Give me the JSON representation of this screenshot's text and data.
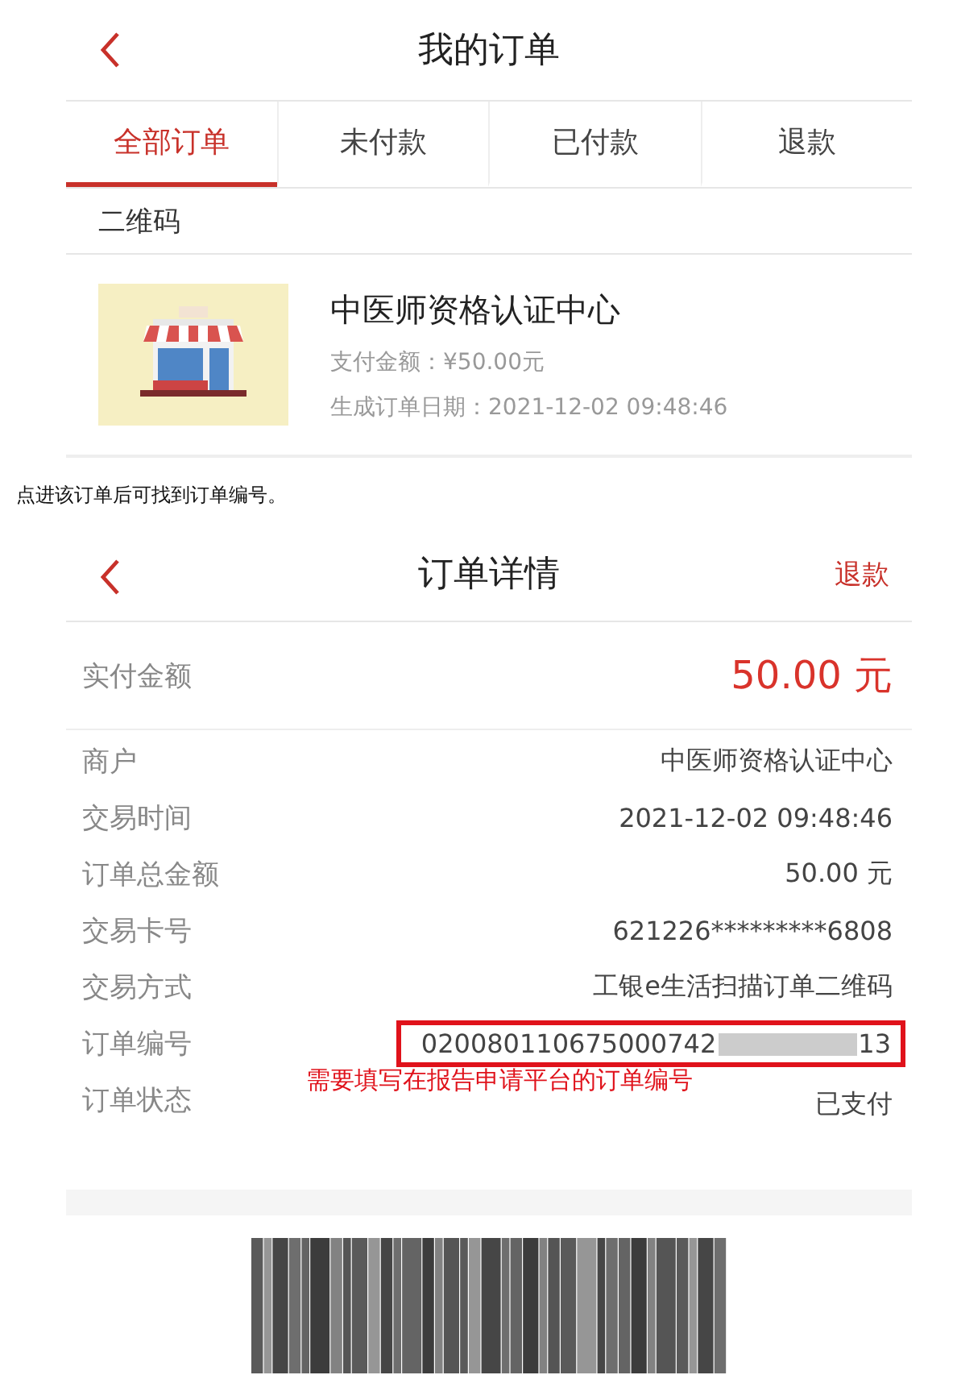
{
  "orders_screen": {
    "title": "我的订单",
    "tabs": [
      {
        "label": "全部订单",
        "selected": true
      },
      {
        "label": "未付款",
        "selected": false
      },
      {
        "label": "已付款",
        "selected": false
      },
      {
        "label": "退款",
        "selected": false
      }
    ],
    "section_label": "二维码",
    "order": {
      "merchant": "中医师资格认证中心",
      "amount": "支付金额：¥50.00元",
      "date": "生成订单日期：2021-12-02 09:48:46"
    }
  },
  "caption": "点进该订单后可找到订单编号。",
  "detail_screen": {
    "title": "订单详情",
    "action": "退款",
    "paid": {
      "label": "实付金额",
      "value": "50.00 元"
    },
    "rows": [
      {
        "label": "商户",
        "value": "中医师资格认证中心"
      },
      {
        "label": "交易时间",
        "value": "2021-12-02  09:48:46"
      },
      {
        "label": "订单总金额",
        "value": "50.00 元"
      },
      {
        "label": "交易卡号",
        "value": "621226*********6808"
      },
      {
        "label": "交易方式",
        "value": "工银e生活扫描订单二维码"
      }
    ],
    "order_number": {
      "label": "订单编号",
      "value_start": "020080110675000742",
      "value_end": "13"
    },
    "annotation": "需要填写在报告申请平台的订单编号",
    "status": {
      "label": "订单状态",
      "value": "已支付"
    }
  }
}
